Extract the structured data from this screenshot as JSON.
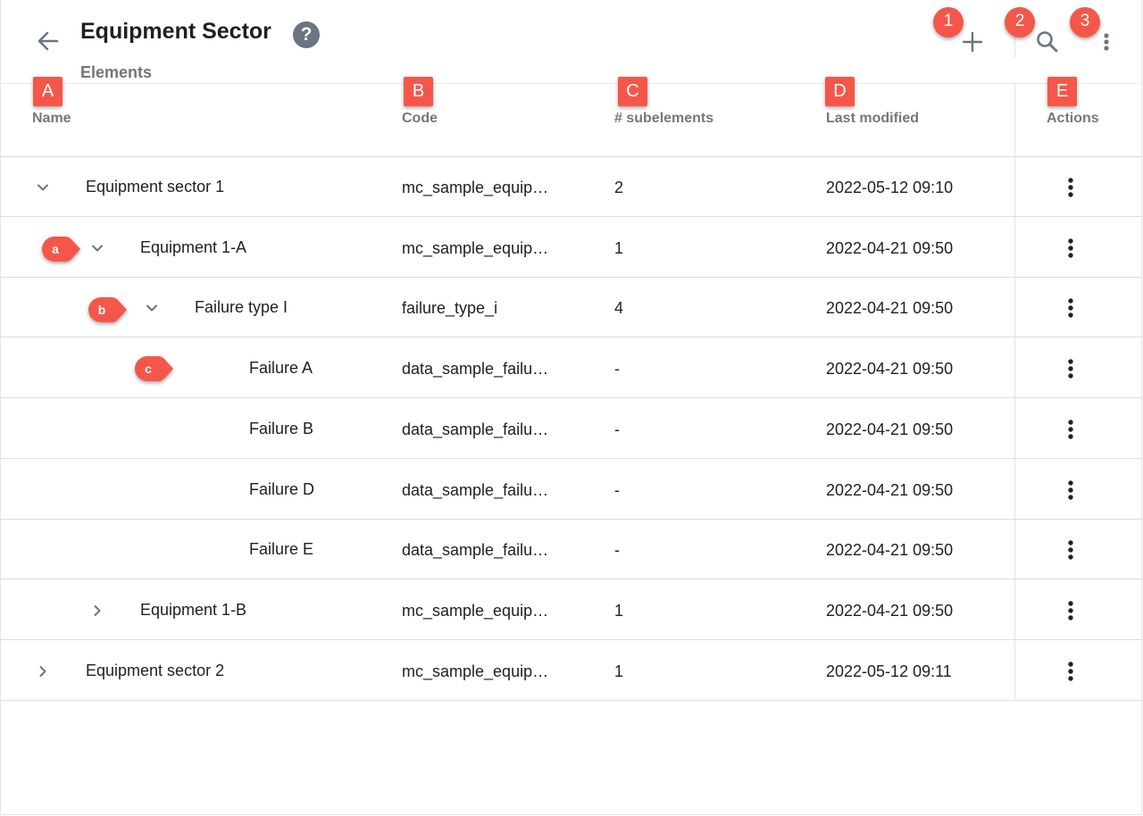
{
  "header": {
    "title": "Equipment Sector",
    "subtitle": "Elements",
    "help_glyph": "?",
    "icons": {
      "back": "arrow-left-icon",
      "add": "plus-icon",
      "search": "search-icon",
      "more": "more-vertical-icon"
    }
  },
  "table": {
    "columns": {
      "name": "Name",
      "code": "Code",
      "subelements": "# subelements",
      "modified": "Last modified",
      "actions": "Actions"
    },
    "rows": [
      {
        "name": "Equipment sector 1",
        "code": "mc_sample_equip…",
        "subelements": "2",
        "modified": "2022-05-12 09:10",
        "level": 0,
        "toggle": "expanded"
      },
      {
        "name": "Equipment 1-A",
        "code": "mc_sample_equip…",
        "subelements": "1",
        "modified": "2022-04-21 09:50",
        "level": 1,
        "toggle": "expanded"
      },
      {
        "name": "Failure type I",
        "code": "failure_type_i",
        "subelements": "4",
        "modified": "2022-04-21 09:50",
        "level": 2,
        "toggle": "expanded"
      },
      {
        "name": "Failure A",
        "code": "data_sample_failu…",
        "subelements": "-",
        "modified": "2022-04-21 09:50",
        "level": 3,
        "toggle": "none"
      },
      {
        "name": "Failure B",
        "code": "data_sample_failu…",
        "subelements": "-",
        "modified": "2022-04-21 09:50",
        "level": 3,
        "toggle": "none"
      },
      {
        "name": "Failure D",
        "code": "data_sample_failu…",
        "subelements": "-",
        "modified": "2022-04-21 09:50",
        "level": 3,
        "toggle": "none"
      },
      {
        "name": "Failure E",
        "code": "data_sample_failu…",
        "subelements": "-",
        "modified": "2022-04-21 09:50",
        "level": 3,
        "toggle": "none"
      },
      {
        "name": "Equipment 1-B",
        "code": "mc_sample_equip…",
        "subelements": "1",
        "modified": "2022-04-21 09:50",
        "level": 1,
        "toggle": "collapsed"
      },
      {
        "name": "Equipment sector 2",
        "code": "mc_sample_equip…",
        "subelements": "1",
        "modified": "2022-05-12 09:11",
        "level": 0,
        "toggle": "collapsed"
      }
    ]
  },
  "annotations": {
    "columns": [
      "A",
      "B",
      "C",
      "D",
      "E"
    ],
    "toolbar": [
      "1",
      "2",
      "3"
    ],
    "rows": [
      "a",
      "b",
      "c"
    ]
  },
  "colors": {
    "callout": "#f4574a",
    "icon": "#6b7480",
    "header_text": "#777777",
    "text": "#212121"
  }
}
